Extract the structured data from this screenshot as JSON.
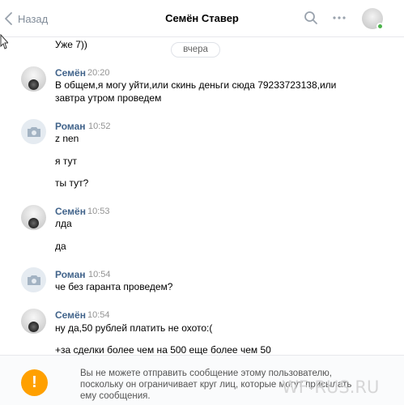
{
  "header": {
    "back_label": "Назад",
    "title": "Семён Ставер",
    "icons": [
      "search-icon",
      "more-icon",
      "avatar"
    ]
  },
  "date_divider": "вчера",
  "partial_message": "Уже 7))",
  "messages": [
    {
      "author": "Семён",
      "time": "20:20",
      "avatar": "semen",
      "lines": [
        "В общем,я могу уйти,или скинь деньги сюда 79233723138,или",
        "завтра утром проведем"
      ]
    },
    {
      "author": "Роман",
      "time": "10:52",
      "avatar": "roman",
      "lines": [
        "z nen",
        "я тут",
        "ты тут?"
      ]
    },
    {
      "author": "Семён",
      "time": "10:53",
      "avatar": "semen",
      "lines": [
        "лда",
        "да"
      ]
    },
    {
      "author": "Роман",
      "time": "10:54",
      "avatar": "roman",
      "lines": [
        "че без гаранта проведем?"
      ]
    },
    {
      "author": "Семён",
      "time": "10:54",
      "avatar": "semen",
      "lines": [
        "ну да,50 рублей платить не охото:(",
        "+за сделки более чем на 500 еще более чем 50"
      ]
    }
  ],
  "notice": {
    "icon": "!",
    "text": "Вы не можете отправить сообщение этому пользователю, поскольку он ограничивает круг лиц, которые могут присылать ему сообщения."
  },
  "watermark": "WF-RUS.RU",
  "colors": {
    "link": "#42648b",
    "time": "#939393",
    "warning": "#ffa000",
    "online": "#4bb34b"
  }
}
